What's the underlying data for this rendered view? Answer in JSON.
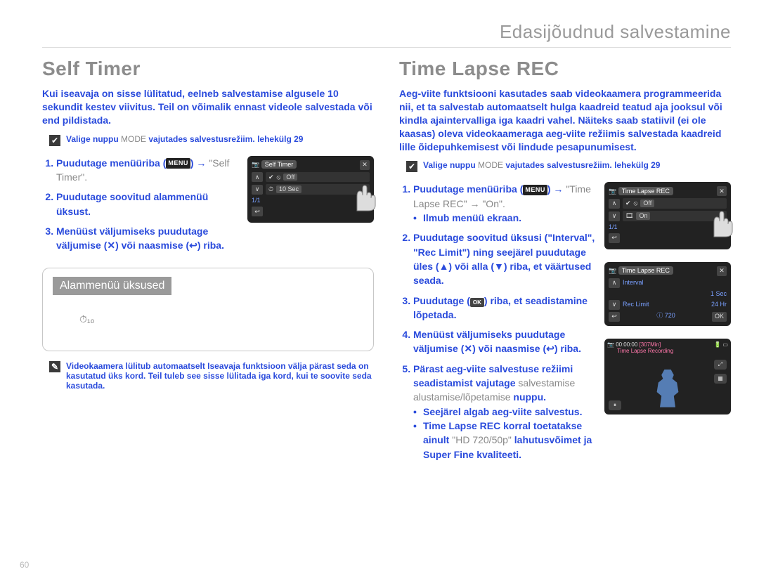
{
  "header": {
    "breadcrumb": "Edasijõudnud salvestamine"
  },
  "page_number": "60",
  "left": {
    "title": "Self Timer",
    "lead": "Kui iseavaja on sisse lülitatud, eelneb salvestamise algusele 10 sekundit kestev viivitus. Teil on võimalik ennast videole salvestada või end pildistada.",
    "precheck": {
      "prefix": "Valige nuppu ",
      "mode": "MODE",
      "suffix": " vajutades salvestusrežiim. lehekülg 29"
    },
    "menu_badge": "MENU",
    "steps": {
      "s1a": "Puudutage menüüriba ",
      "s1b": "\"Self Timer\".",
      "s2": "Puudutage soovitud alammenüü üksust.",
      "s3": "Menüüst väljumiseks puudutage väljumise (✕) või naasmise (↩) riba."
    },
    "subitems_header": "Alammenüü üksused",
    "timer_icon_text": "⏱₁₀",
    "note": "Videokaamera lülitub automaatselt Iseavaja funktsioon välja pärast seda on kasutatud üks kord. Teil tuleb see sisse lülitada iga kord, kui te soovite seda kasutada.",
    "cam": {
      "title": "Self Timer",
      "opt_off": "Off",
      "opt_10": "10 Sec",
      "page": "1/1"
    }
  },
  "right": {
    "title": "Time Lapse REC",
    "lead": "Aeg-viite funktsiooni kasutades saab videokaamera programmeerida nii, et ta salvestab automaatselt hulga kaadreid teatud aja jooksul või kindla ajaintervalliga iga kaadri vahel. Näiteks saab statiivil (ei ole kaasas) oleva videokaameraga aeg-viite režiimis salvestada kaadreid lille õidepuhkemisest või lindude pesapunumisest.",
    "precheck": {
      "prefix": "Valige nuppu ",
      "mode": "MODE",
      "suffix": " vajutades salvestusrežiim.  lehekülg 29"
    },
    "menu_badge": "MENU",
    "steps": {
      "s1a": "Puudutage menüüriba ",
      "s1b_grey": "\"Time Lapse REC\" → \"On\".",
      "s1c": "Ilmub menüü ekraan.",
      "s2": "Puudutage soovitud üksusi (\"Interval\", \"Rec Limit\") ning seejärel puudutage üles (▲) või alla (▼) riba, et väärtused seada.",
      "s3a": "Puudutage (",
      "s3b": ") riba, et seadistamine lõpetada.",
      "s4": "Menüüst väljumiseks puudutage väljumise (✕) või naasmise (↩) riba.",
      "s5a": "Pärast aeg-viite salvestuse režiimi seadistamist vajutage ",
      "s5b_grey": "salvestamise alustamise/lõpetamise",
      "s5c": " nuppu.",
      "s5d": "Seejärel algab aeg-viite salvestus.",
      "s5e_pre": "Time Lapse REC korral toetatakse ainult ",
      "s5e_grey": "\"HD 720/50p\"",
      "s5e_post": " lahutusvõimet ja Super Fine kvaliteeti."
    },
    "cam1": {
      "title": "Time Lapse REC",
      "off": "Off",
      "on": "On",
      "page": "1/1"
    },
    "cam2": {
      "title": "Time Lapse REC",
      "interval_label": "Interval",
      "interval_val": "1   Sec",
      "rec_label": "Rec Limit",
      "rec_val": "24  Hr",
      "res": "ⓘ 720",
      "ok": "OK"
    },
    "cam3": {
      "time": "00:00:00",
      "remain": "[307Min]",
      "label": "Time Lapse Recording"
    }
  }
}
